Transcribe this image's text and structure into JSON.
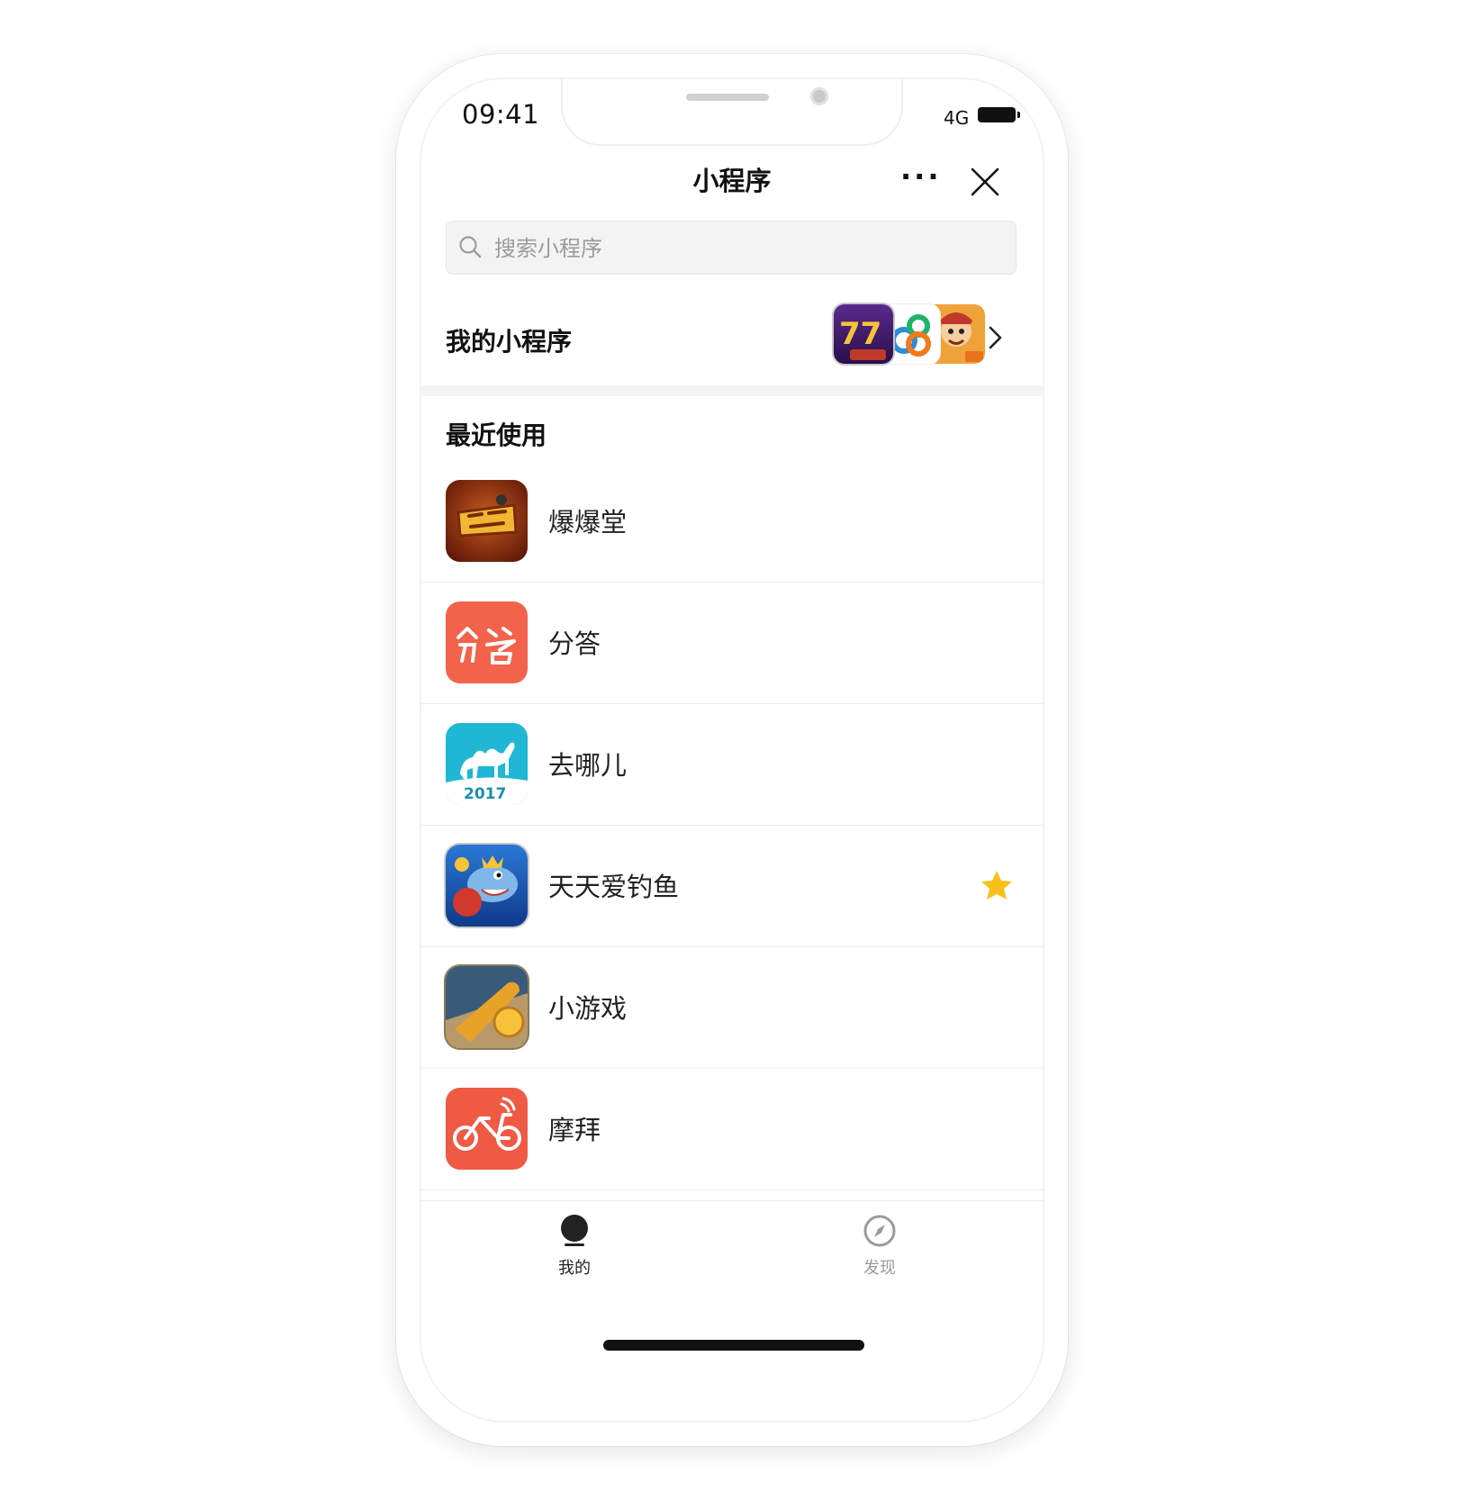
{
  "status_bar": {
    "time": "09:41",
    "network": "4G"
  },
  "nav": {
    "title": "小程序",
    "more_label": "···"
  },
  "search": {
    "placeholder": "搜索小程序"
  },
  "my_mini_programs": {
    "label": "我的小程序",
    "preview_icons": [
      "slot-machine-icon",
      "sixty-eight-icon",
      "cartoon-game-icon"
    ]
  },
  "recent": {
    "title": "最近使用",
    "items": [
      {
        "name": "爆爆堂",
        "icon": "baobaotang-icon",
        "starred": false
      },
      {
        "name": "分答",
        "icon": "fenda-icon",
        "starred": false
      },
      {
        "name": "去哪儿",
        "icon": "qunar-camel-icon",
        "starred": false,
        "icon_text": "2017"
      },
      {
        "name": "天天爱钓鱼",
        "icon": "fishing-game-icon",
        "starred": true
      },
      {
        "name": "小游戏",
        "icon": "mini-game-icon",
        "starred": false
      },
      {
        "name": "摩拜",
        "icon": "mobike-icon",
        "starred": false
      },
      {
        "name": "",
        "icon": "panda-game-icon",
        "starred": false
      }
    ]
  },
  "tabbar": {
    "tabs": [
      {
        "label": "我的",
        "icon": "user-icon",
        "active": true
      },
      {
        "label": "发现",
        "icon": "compass-icon",
        "active": false
      }
    ]
  },
  "colors": {
    "star": "#f7c11b",
    "active_tab": "#222222",
    "inactive_tab": "#9b9b9b",
    "mobike": "#ef5a45",
    "fenda": "#f3624b",
    "qunar": "#1fb7d3"
  }
}
